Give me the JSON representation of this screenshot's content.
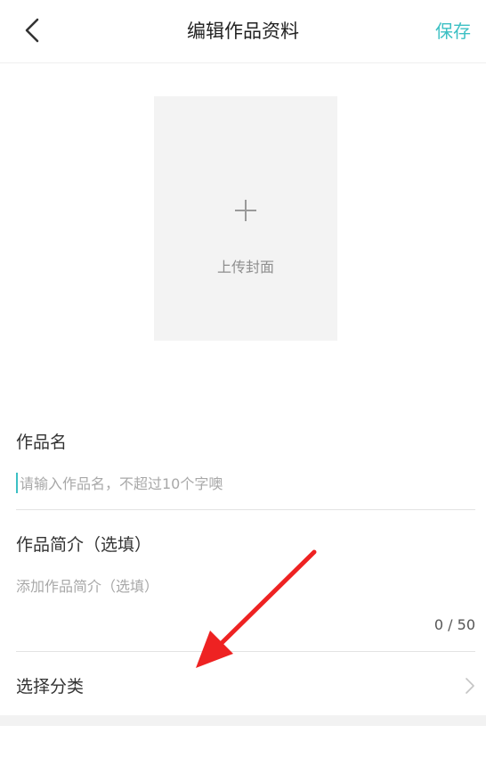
{
  "header": {
    "title": "编辑作品资料",
    "save_label": "保存",
    "back_icon": "chevron-left-icon"
  },
  "cover": {
    "label": "上传封面",
    "icon": "plus-icon"
  },
  "name_field": {
    "label": "作品名",
    "placeholder": "请输入作品名，不超过10个字噢",
    "value": ""
  },
  "intro_field": {
    "label": "作品简介（选填）",
    "placeholder": "添加作品简介（选填）",
    "value": "",
    "char_count": "0 / 50"
  },
  "category": {
    "label": "选择分类",
    "icon": "chevron-right-icon"
  },
  "colors": {
    "accent": "#3cc0c4",
    "annotation_arrow": "#ee2222"
  }
}
